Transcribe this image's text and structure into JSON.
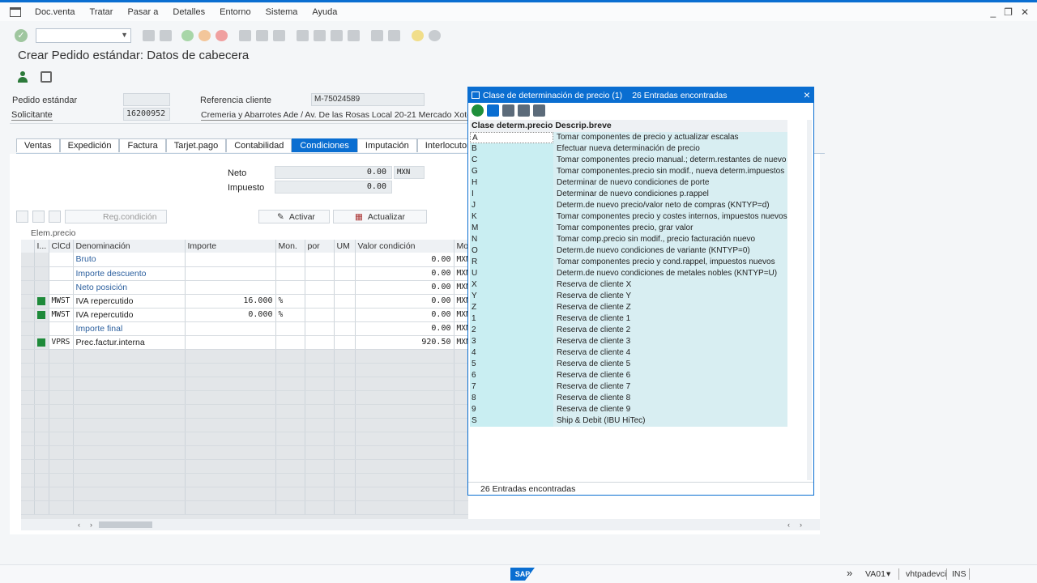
{
  "menubar": {
    "items": [
      "Doc.venta",
      "Tratar",
      "Pasar a",
      "Detalles",
      "Entorno",
      "Sistema",
      "Ayuda"
    ]
  },
  "window_controls": [
    "_",
    "❐",
    "✕"
  ],
  "page_title": "Crear Pedido estándar: Datos de cabecera",
  "header": {
    "pedido_label": "Pedido estándar",
    "pedido_value": "",
    "solicitante_label": "Solicitante",
    "solicitante_value": "16200952",
    "referencia_label": "Referencia cliente",
    "referencia_value": "M-75024589",
    "address": "Cremeria y Abarrotes Ade / Av. De las Rosas Local 20-21 Mercado Xote"
  },
  "tabs": [
    "Ventas",
    "Expedición",
    "Factura",
    "Tarjet.pago",
    "Contabilidad",
    "Condiciones",
    "Imputación",
    "Interlocutor"
  ],
  "active_tab": "Condiciones",
  "totals": {
    "neto_label": "Neto",
    "neto_value": "0.00",
    "neto_currency": "MXN",
    "impuesto_label": "Impuesto",
    "impuesto_value": "0.00"
  },
  "grid_toolbar": {
    "reg_condicion": "Reg.condición",
    "activar": "Activar",
    "actualizar": "Actualizar"
  },
  "elem_label": "Elem.precio",
  "table": {
    "columns": [
      "I...",
      "ClCd",
      "Denominación",
      "Importe",
      "Mon.",
      "por",
      "UM",
      "Valor condición",
      "Mo"
    ],
    "rows": [
      {
        "sq": false,
        "clcd": "",
        "denom": "Bruto",
        "importe": "",
        "mon": "",
        "valor": "0.00",
        "mo": "MXN",
        "blue": true
      },
      {
        "sq": false,
        "clcd": "",
        "denom": "Importe descuento",
        "importe": "",
        "mon": "",
        "valor": "0.00",
        "mo": "MXN",
        "blue": true
      },
      {
        "sq": false,
        "clcd": "",
        "denom": "Neto posición",
        "importe": "",
        "mon": "",
        "valor": "0.00",
        "mo": "MXN",
        "blue": true
      },
      {
        "sq": true,
        "clcd": "MWST",
        "denom": "IVA repercutido",
        "importe": "16.000",
        "mon": "%",
        "valor": "0.00",
        "mo": "MXN",
        "blue": false
      },
      {
        "sq": true,
        "clcd": "MWST",
        "denom": "IVA repercutido",
        "importe": "0.000",
        "mon": "%",
        "valor": "0.00",
        "mo": "MXN",
        "blue": false
      },
      {
        "sq": false,
        "clcd": "",
        "denom": "Importe final",
        "importe": "",
        "mon": "",
        "valor": "0.00",
        "mo": "MXN",
        "blue": true
      },
      {
        "sq": true,
        "clcd": "VPRS",
        "denom": "Prec.factur.interna",
        "importe": "",
        "mon": "",
        "valor": "920.50",
        "mo": "MXN",
        "blue": false
      }
    ]
  },
  "popup": {
    "title": "Clase de determinación de precio (1)",
    "count_title": "26 Entradas encontradas",
    "col_key": "Clase determ.precio",
    "col_desc": "Descrip.breve",
    "footer": "26 Entradas encontradas",
    "entries": [
      {
        "k": "A",
        "d": "Tomar componentes de precio y actualizar escalas"
      },
      {
        "k": "B",
        "d": "Efectuar nueva determinación de precio"
      },
      {
        "k": "C",
        "d": "Tomar componentes precio manual.; determ.restantes de nuevo"
      },
      {
        "k": "G",
        "d": "Tomar componentes.precio sin modif., nueva determ.impuestos"
      },
      {
        "k": "H",
        "d": "Determinar de nuevo condiciones de porte"
      },
      {
        "k": "I",
        "d": "Determinar de nuevo condiciones p.rappel"
      },
      {
        "k": "J",
        "d": "Determ.de nuevo precio/valor neto de compras (KNTYP=d)"
      },
      {
        "k": "K",
        "d": "Tomar componentes precio y costes internos, impuestos nuevos"
      },
      {
        "k": "M",
        "d": "Tomar componentes precio, grar valor"
      },
      {
        "k": "N",
        "d": "Tomar comp.precio sin modif., precio facturación nuevo"
      },
      {
        "k": "O",
        "d": "Determ.de nuevo condiciones de variante (KNTYP=0)"
      },
      {
        "k": "R",
        "d": "Tomar componentes precio y cond.rappel, impuestos nuevos"
      },
      {
        "k": "U",
        "d": "Determ.de nuevo condiciones de metales nobles (KNTYP=U)"
      },
      {
        "k": "X",
        "d": "Reserva de cliente X"
      },
      {
        "k": "Y",
        "d": "Reserva de cliente Y"
      },
      {
        "k": "Z",
        "d": "Reserva de cliente Z"
      },
      {
        "k": "1",
        "d": "Reserva de cliente 1"
      },
      {
        "k": "2",
        "d": "Reserva de cliente 2"
      },
      {
        "k": "3",
        "d": "Reserva de cliente 3"
      },
      {
        "k": "4",
        "d": "Reserva de cliente 4"
      },
      {
        "k": "5",
        "d": "Reserva de cliente 5"
      },
      {
        "k": "6",
        "d": "Reserva de cliente 6"
      },
      {
        "k": "7",
        "d": "Reserva de cliente 7"
      },
      {
        "k": "8",
        "d": "Reserva de cliente 8"
      },
      {
        "k": "9",
        "d": "Reserva de cliente 9"
      },
      {
        "k": "S",
        "d": "Ship & Debit  (IBU HiTec)"
      }
    ]
  },
  "statusbar": {
    "logo": "SAP",
    "tcode": "VA01",
    "server": "vhtpadevci",
    "mode": "INS"
  },
  "colors": {
    "accent": "#0a6ed1",
    "status_green": "#1e8a3a"
  }
}
